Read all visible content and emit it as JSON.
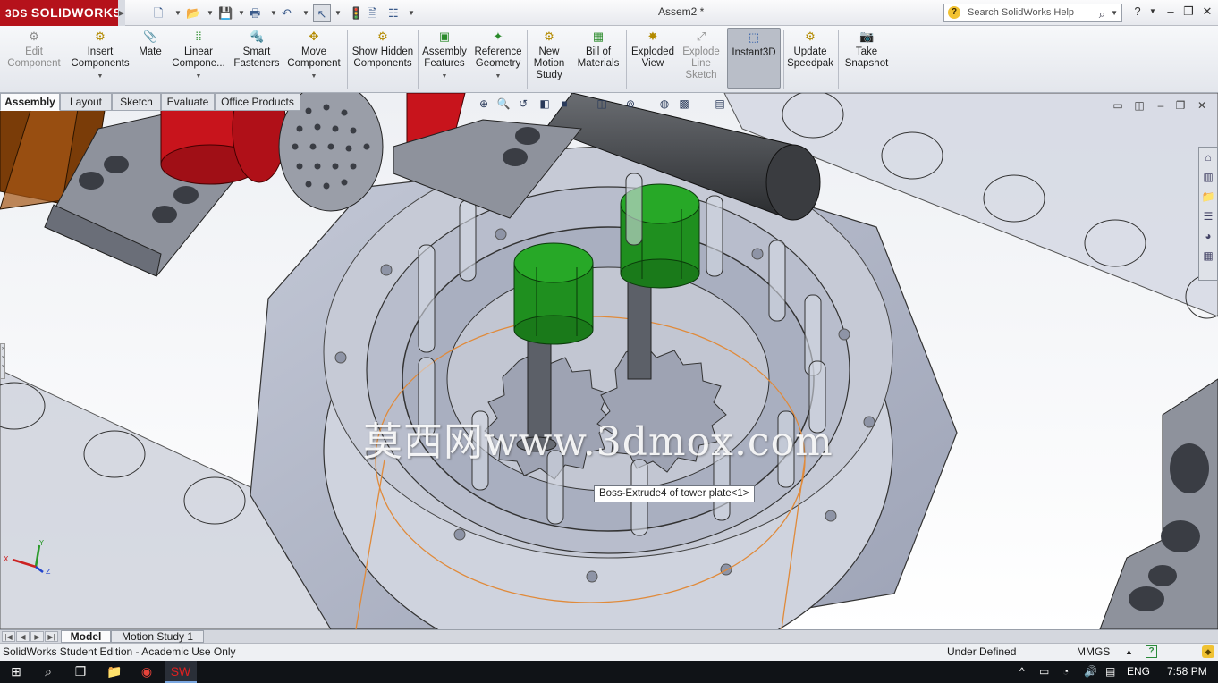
{
  "app": {
    "brand": "SOLIDWORKS",
    "document_title": "Assem2 *",
    "search_placeholder": "Search SolidWorks Help"
  },
  "quick_access": [
    {
      "icon": "new-document-icon"
    },
    {
      "icon": "open-folder-icon"
    },
    {
      "icon": "save-icon"
    },
    {
      "icon": "print-icon"
    },
    {
      "icon": "undo-icon"
    },
    {
      "icon": "select-pointer-icon"
    },
    {
      "icon": "rebuild-icon"
    },
    {
      "icon": "file-properties-icon"
    },
    {
      "icon": "options-icon"
    }
  ],
  "commands": [
    {
      "label": "Edit Component",
      "icon": "edit-component-icon",
      "enabled": false
    },
    {
      "label": "Insert Components",
      "icon": "insert-components-icon",
      "enabled": true
    },
    {
      "label": "Mate",
      "icon": "mate-icon",
      "enabled": true
    },
    {
      "label": "Linear Compone...",
      "icon": "linear-pattern-icon",
      "enabled": true
    },
    {
      "label": "Smart Fasteners",
      "icon": "smart-fasteners-icon",
      "enabled": true
    },
    {
      "label": "Move Component",
      "icon": "move-component-icon",
      "enabled": true
    },
    {
      "label": "Show Hidden Components",
      "icon": "show-hidden-icon",
      "enabled": true
    },
    {
      "label": "Assembly Features",
      "icon": "assembly-features-icon",
      "enabled": true
    },
    {
      "label": "Reference Geometry",
      "icon": "reference-geometry-icon",
      "enabled": true
    },
    {
      "label": "New Motion Study",
      "icon": "motion-study-icon",
      "enabled": true
    },
    {
      "label": "Bill of Materials",
      "icon": "bill-of-materials-icon",
      "enabled": true
    },
    {
      "label": "Exploded View",
      "icon": "exploded-view-icon",
      "enabled": true
    },
    {
      "label": "Explode Line Sketch",
      "icon": "explode-line-icon",
      "enabled": false
    },
    {
      "label": "Instant3D",
      "icon": "instant3d-icon",
      "enabled": true,
      "active": true
    },
    {
      "label": "Update Speedpak",
      "icon": "speedpak-icon",
      "enabled": true
    },
    {
      "label": "Take Snapshot",
      "icon": "snapshot-icon",
      "enabled": true
    }
  ],
  "tabs": [
    "Assembly",
    "Layout",
    "Sketch",
    "Evaluate",
    "Office Products"
  ],
  "active_tab": "Assembly",
  "viewport": {
    "watermark": "莫西网www.3dmox.com",
    "tooltip": "Boss-Extrude4 of tower plate<1>",
    "triad_labels": {
      "x": "X",
      "y": "Y",
      "z": "Z"
    }
  },
  "bottom_tabs": [
    "Model",
    "Motion Study 1"
  ],
  "status": {
    "edition": "SolidWorks Student Edition - Academic Use Only",
    "state": "Under Defined",
    "units": "MMGS"
  },
  "taskbar": {
    "language": "ENG",
    "time": "7:58 PM"
  },
  "colors": {
    "brand_red": "#b5121b",
    "gear_green": "#1f8f1f",
    "part_red": "#c8141c",
    "part_brown": "#8a4a10"
  }
}
